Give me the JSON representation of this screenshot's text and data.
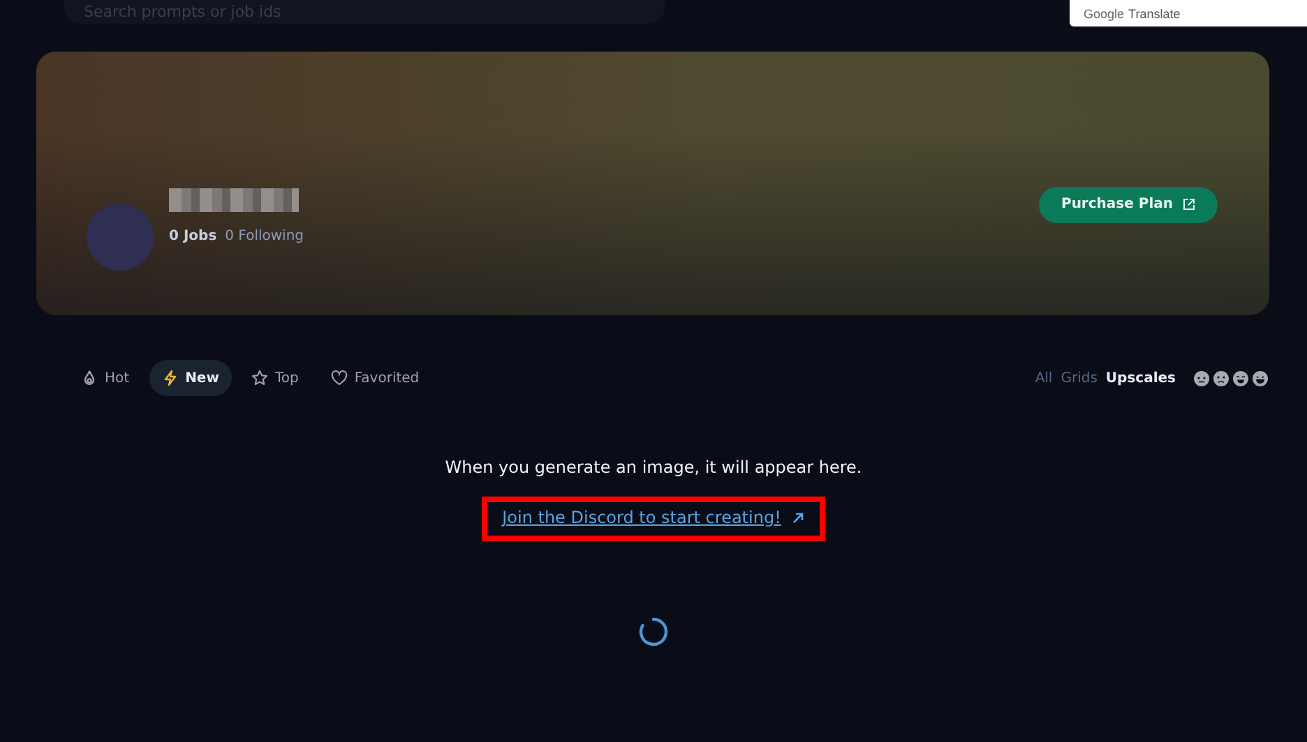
{
  "search": {
    "placeholder": "Search prompts or job ids"
  },
  "translate_popup": {
    "brand": "Google",
    "label": "Translate"
  },
  "profile": {
    "jobs": "0 Jobs",
    "following": "0 Following",
    "button": "Purchase Plan"
  },
  "tabs": [
    {
      "label": "Hot",
      "kind": "flame",
      "selected": false
    },
    {
      "label": "New",
      "kind": "bolt",
      "selected": true
    },
    {
      "label": "Top",
      "kind": "star",
      "selected": false
    },
    {
      "label": "Favorited",
      "kind": "heart",
      "selected": false
    }
  ],
  "filters": [
    {
      "label": "All",
      "selected": false
    },
    {
      "label": "Grids",
      "selected": false
    },
    {
      "label": "Upscales",
      "selected": true
    }
  ],
  "moods": [
    {
      "kind": "neutral",
      "selected": false
    },
    {
      "kind": "sad",
      "selected": false
    },
    {
      "kind": "happy",
      "selected": false
    },
    {
      "kind": "laugh",
      "selected": false
    }
  ],
  "empty_state": {
    "message": "When you generate an image, it will appear here.",
    "link": "Join the Discord to start creating!",
    "highlighted": true
  }
}
